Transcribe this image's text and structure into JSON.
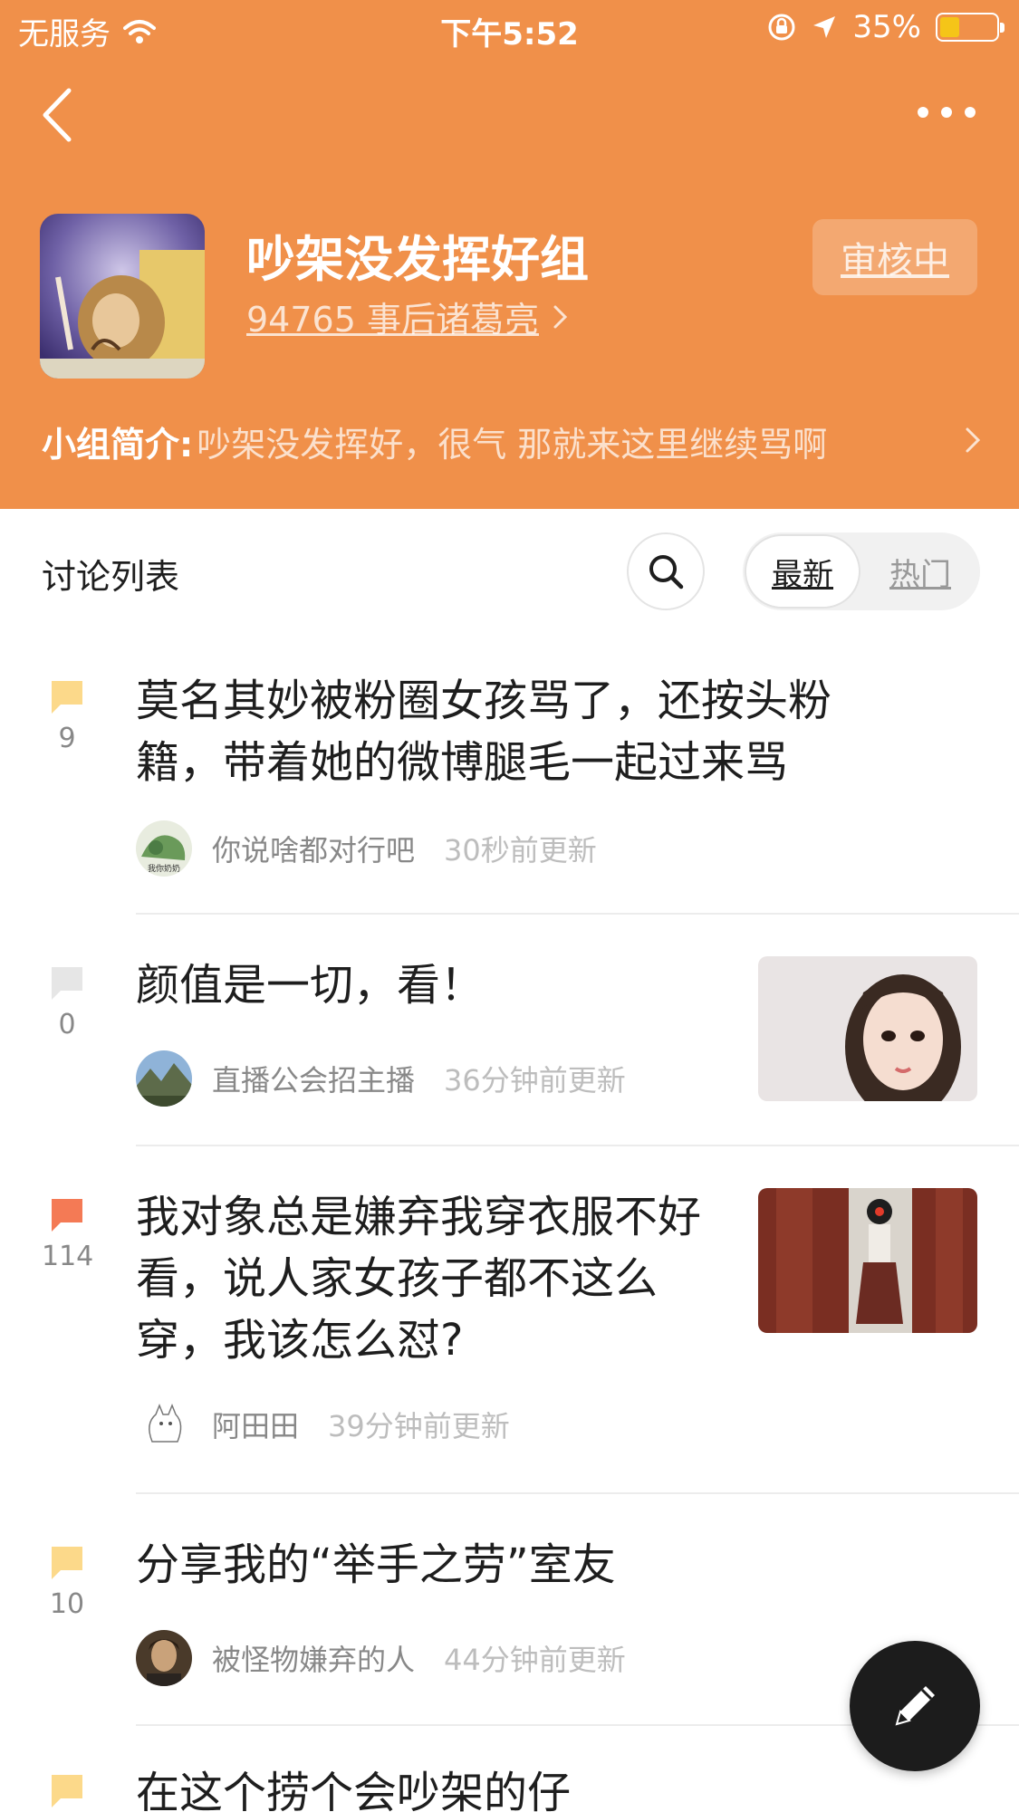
{
  "status_bar": {
    "carrier": "无服务",
    "time": "下午5:52",
    "battery": "35%",
    "battery_level": 0.35,
    "battery_color": "#f5c518"
  },
  "nav": {
    "back_icon": "chevron-left-icon",
    "more_icon": "more-horizontal-icon"
  },
  "group": {
    "title": "吵架没发挥好组",
    "member_info": "94765 事后诸葛亮",
    "review_label": "审核中",
    "intro_label": "小组简介:",
    "intro_text": "吵架没发挥好，很气 那就来这里继续骂啊",
    "header_color": "#f0904a"
  },
  "toolbar": {
    "title": "讨论列表",
    "search_icon": "search-icon",
    "tab_latest": "最新",
    "tab_hot": "热门"
  },
  "posts": [
    {
      "title": "莫名其妙被粉圈女孩骂了，还按头粉籍，带着她的微博腿毛一起过来骂",
      "comments": "9",
      "badge_color": "#fcd98a",
      "user": "你说啥都对行吧",
      "time": "30秒前更新",
      "avatar_text": "我你奶奶"
    },
    {
      "title": "颜值是一切，看！",
      "comments": "0",
      "badge_color": "#e6e6e6",
      "user": "直播公会招主播",
      "time": "36分钟前更新"
    },
    {
      "title": "我对象总是嫌弃我穿衣服不好看，说人家女孩子都不这么穿，我该怎么怼?",
      "comments": "114",
      "badge_color": "#f47a55",
      "user": "阿田田",
      "time": "39分钟前更新"
    },
    {
      "title": "分享我的“举手之劳”室友",
      "comments": "10",
      "badge_color": "#fcd98a",
      "user": "被怪物嫌弃的人",
      "time": "44分钟前更新"
    },
    {
      "title": "在这个捞个会吵架的仔",
      "comments": "",
      "badge_color": "#fcd98a"
    }
  ],
  "fab": {
    "icon": "pencil-icon"
  }
}
